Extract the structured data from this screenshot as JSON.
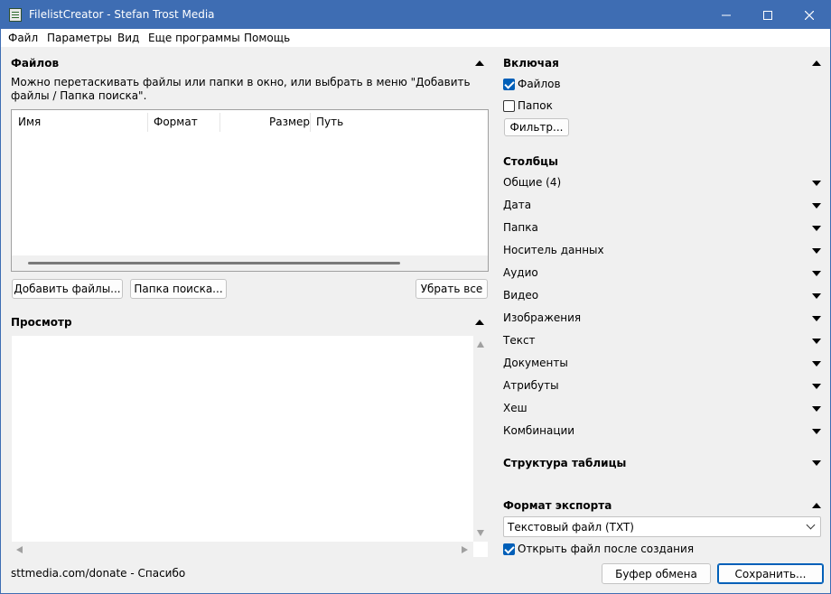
{
  "window": {
    "title": "FilelistCreator - Stefan Trost Media",
    "icon": "app-icon",
    "controls": [
      "minimize-icon",
      "maximize-icon",
      "close-icon"
    ]
  },
  "menu": [
    "Файл",
    "Параметры",
    "Вид",
    "Еще программы",
    "Помощь"
  ],
  "files_panel": {
    "title": "Файлов",
    "hint": "Можно перетаскивать файлы или папки в окно, или выбрать в меню \"Добавить файлы / Папка поиска\".",
    "columns": [
      "Имя",
      "Формат",
      "Размер",
      "Путь"
    ],
    "buttons": {
      "add_files": "Добавить файлы...",
      "search_folder": "Папка поиска...",
      "remove_all": "Убрать все"
    }
  },
  "preview_panel": {
    "title": "Просмотр"
  },
  "footer": {
    "donate": "sttmedia.com/donate - Спасибо"
  },
  "include_panel": {
    "title": "Включая",
    "files_label": "Файлов",
    "files_checked": true,
    "folders_label": "Папок",
    "folders_checked": false,
    "filter_button": "Фильтр..."
  },
  "columns_panel": {
    "title": "Столбцы",
    "items": [
      "Общие (4)",
      "Дата",
      "Папка",
      "Носитель данных",
      "Аудио",
      "Видео",
      "Изображения",
      "Текст",
      "Документы",
      "Атрибуты",
      "Хеш",
      "Комбинации"
    ]
  },
  "table_structure": {
    "title": "Структура таблицы"
  },
  "export_panel": {
    "title": "Формат экспорта",
    "format_value": "Текстовый файл (TXT)",
    "open_after_label": "Открыть файл после создания",
    "open_after_checked": true,
    "clipboard_button": "Буфер обмена",
    "save_button": "Сохранить..."
  },
  "colors": {
    "titlebar": "#3e6db3",
    "accent": "#005fb8",
    "background": "#f0f0f0"
  }
}
